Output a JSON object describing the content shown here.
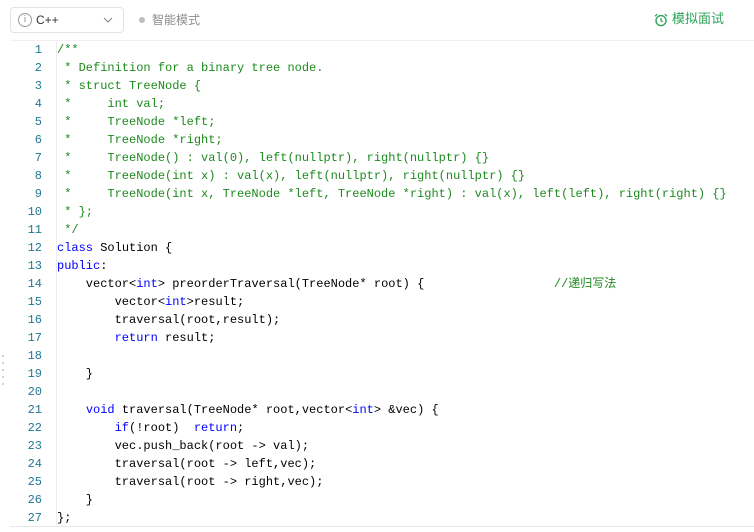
{
  "toolbar": {
    "language": "C++",
    "mode_label": "智能模式",
    "mock_interview_label": "模拟面试",
    "colors": {
      "accent_green": "#2fa35a",
      "muted": "#8c8c8c"
    },
    "icons": {
      "info": "info-icon",
      "dropdown": "chevron-down-icon",
      "mock": "alarm-clock-icon"
    }
  },
  "editor": {
    "colors": {
      "comment": "#1d8a1d",
      "keyword": "#0000ff",
      "line_number": "#237893"
    },
    "lines": [
      {
        "n": "1",
        "tokens": [
          {
            "t": "/**",
            "c": "comment"
          }
        ]
      },
      {
        "n": "2",
        "tokens": [
          {
            "t": " * Definition for a binary tree node.",
            "c": "comment"
          }
        ]
      },
      {
        "n": "3",
        "tokens": [
          {
            "t": " * struct TreeNode {",
            "c": "comment"
          }
        ]
      },
      {
        "n": "4",
        "tokens": [
          {
            "t": " *     int val;",
            "c": "comment"
          }
        ]
      },
      {
        "n": "5",
        "tokens": [
          {
            "t": " *     TreeNode *left;",
            "c": "comment"
          }
        ]
      },
      {
        "n": "6",
        "tokens": [
          {
            "t": " *     TreeNode *right;",
            "c": "comment"
          }
        ]
      },
      {
        "n": "7",
        "tokens": [
          {
            "t": " *     TreeNode() : val(0), left(nullptr), right(nullptr) {}",
            "c": "comment"
          }
        ]
      },
      {
        "n": "8",
        "tokens": [
          {
            "t": " *     TreeNode(int x) : val(x), left(nullptr), right(nullptr) {}",
            "c": "comment"
          }
        ]
      },
      {
        "n": "9",
        "tokens": [
          {
            "t": " *     TreeNode(int x, TreeNode *left, TreeNode *right) : val(x), left(left), right(right) {}",
            "c": "comment"
          }
        ]
      },
      {
        "n": "10",
        "tokens": [
          {
            "t": " * };",
            "c": "comment"
          }
        ]
      },
      {
        "n": "11",
        "tokens": [
          {
            "t": " */",
            "c": "comment"
          }
        ]
      },
      {
        "n": "12",
        "tokens": [
          {
            "t": "class",
            "c": "keyword"
          },
          {
            "t": " Solution {",
            "c": "plain"
          }
        ]
      },
      {
        "n": "13",
        "tokens": [
          {
            "t": "public",
            "c": "keyword"
          },
          {
            "t": ":",
            "c": "plain"
          }
        ]
      },
      {
        "n": "14",
        "tokens": [
          {
            "t": "    vector<",
            "c": "plain"
          },
          {
            "t": "int",
            "c": "keyword"
          },
          {
            "t": "> preorderTraversal(TreeNode* root) {                  ",
            "c": "plain"
          },
          {
            "t": "//递归写法",
            "c": "comment"
          }
        ]
      },
      {
        "n": "15",
        "tokens": [
          {
            "t": "        vector<",
            "c": "plain"
          },
          {
            "t": "int",
            "c": "keyword"
          },
          {
            "t": ">result;",
            "c": "plain"
          }
        ]
      },
      {
        "n": "16",
        "tokens": [
          {
            "t": "        traversal(root,result);",
            "c": "plain"
          }
        ]
      },
      {
        "n": "17",
        "tokens": [
          {
            "t": "        ",
            "c": "plain"
          },
          {
            "t": "return",
            "c": "keyword"
          },
          {
            "t": " result;",
            "c": "plain"
          }
        ]
      },
      {
        "n": "18",
        "tokens": []
      },
      {
        "n": "19",
        "tokens": [
          {
            "t": "    }",
            "c": "plain"
          }
        ]
      },
      {
        "n": "20",
        "tokens": []
      },
      {
        "n": "21",
        "tokens": [
          {
            "t": "    ",
            "c": "plain"
          },
          {
            "t": "void",
            "c": "keyword"
          },
          {
            "t": " traversal(TreeNode* root,vector<",
            "c": "plain"
          },
          {
            "t": "int",
            "c": "keyword"
          },
          {
            "t": "> &vec) {",
            "c": "plain"
          }
        ]
      },
      {
        "n": "22",
        "tokens": [
          {
            "t": "        ",
            "c": "plain"
          },
          {
            "t": "if",
            "c": "keyword"
          },
          {
            "t": "(!root)  ",
            "c": "plain"
          },
          {
            "t": "return",
            "c": "keyword"
          },
          {
            "t": ";",
            "c": "plain"
          }
        ]
      },
      {
        "n": "23",
        "tokens": [
          {
            "t": "        vec.push_back(root -> val);",
            "c": "plain"
          }
        ]
      },
      {
        "n": "24",
        "tokens": [
          {
            "t": "        traversal(root -> left,vec);",
            "c": "plain"
          }
        ]
      },
      {
        "n": "25",
        "tokens": [
          {
            "t": "        traversal(root -> right,vec);",
            "c": "plain"
          }
        ]
      },
      {
        "n": "26",
        "tokens": [
          {
            "t": "    }",
            "c": "plain"
          }
        ]
      },
      {
        "n": "27",
        "tokens": [
          {
            "t": "};",
            "c": "plain"
          }
        ]
      }
    ]
  }
}
